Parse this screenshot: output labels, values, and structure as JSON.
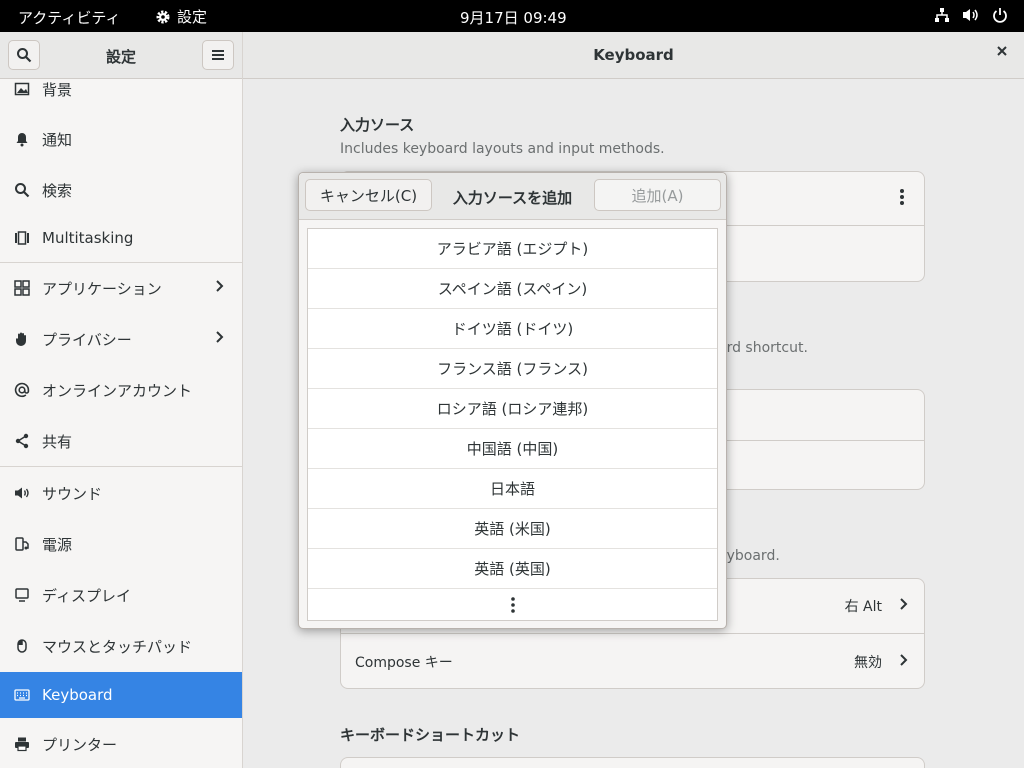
{
  "topbar": {
    "activities": "アクティビティ",
    "app_name": "設定",
    "clock": "9月17日  09:49"
  },
  "sidebar": {
    "title": "設定",
    "items": [
      {
        "label": "背景",
        "icon": "background-icon"
      },
      {
        "label": "通知",
        "icon": "bell-icon"
      },
      {
        "label": "検索",
        "icon": "search-icon"
      },
      {
        "label": "Multitasking",
        "icon": "multitasking-icon"
      },
      {
        "label": "アプリケーション",
        "icon": "apps-grid-icon"
      },
      {
        "label": "プライバシー",
        "icon": "hand-icon"
      },
      {
        "label": "オンラインアカウント",
        "icon": "at-icon"
      },
      {
        "label": "共有",
        "icon": "share-icon"
      },
      {
        "label": "サウンド",
        "icon": "speaker-icon"
      },
      {
        "label": "電源",
        "icon": "power-plug-icon"
      },
      {
        "label": "ディスプレイ",
        "icon": "display-icon"
      },
      {
        "label": "マウスとタッチパッド",
        "icon": "mouse-icon"
      },
      {
        "label": "Keyboard",
        "icon": "keyboard-icon"
      },
      {
        "label": "プリンター",
        "icon": "printer-icon"
      }
    ]
  },
  "main": {
    "title": "Keyboard",
    "input_sources": {
      "title": "入力ソース",
      "desc": "Includes keyboard layouts and input methods."
    },
    "partial_desc": "ard shortcut.",
    "special_desc": "eyboard.",
    "alternate_chars_value": "右 Alt",
    "compose": {
      "label": "Compose キー",
      "value": "無効"
    },
    "shortcuts_title": "キーボードショートカット"
  },
  "dialog": {
    "cancel_label": "キャンセル(C)",
    "title": "入力ソースを追加",
    "add_label": "追加(A)",
    "languages": [
      "アラビア語 (エジプト)",
      "スペイン語 (スペイン)",
      "ドイツ語 (ドイツ)",
      "フランス語 (フランス)",
      "ロシア語 (ロシア連邦)",
      "中国語 (中国)",
      "日本語",
      "英語 (米国)",
      "英語 (英国)"
    ]
  },
  "colors": {
    "accent": "#3584e4",
    "topbar": "#000000"
  }
}
